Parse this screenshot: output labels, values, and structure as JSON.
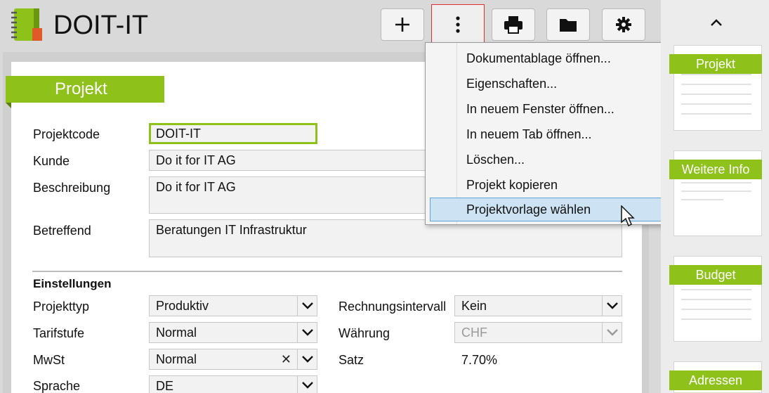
{
  "app": {
    "title": "DOIT-IT"
  },
  "toolbar": {
    "add_icon": "plus-icon",
    "more_icon": "more-vertical-icon",
    "print_icon": "printer-icon",
    "folder_icon": "folder-icon",
    "settings_icon": "gear-icon"
  },
  "section": {
    "title": "Projekt"
  },
  "form": {
    "projektcode": {
      "label": "Projektcode",
      "value": "DOIT-IT"
    },
    "kunde": {
      "label": "Kunde",
      "value": "Do it for IT AG"
    },
    "beschreibung": {
      "label": "Beschreibung",
      "value": "Do it for IT AG"
    },
    "betreffend": {
      "label": "Betreffend",
      "value": "Beratungen IT Infrastruktur"
    }
  },
  "einstellungen": {
    "heading": "Einstellungen",
    "projekttyp": {
      "label": "Projekttyp",
      "value": "Produktiv"
    },
    "tarifstufe": {
      "label": "Tarifstufe",
      "value": "Normal"
    },
    "mwst": {
      "label": "MwSt",
      "value": "Normal"
    },
    "sprache": {
      "label": "Sprache",
      "value": "DE"
    },
    "rechnungsintervall": {
      "label": "Rechnungsintervall",
      "value": "Kein"
    },
    "waehrung": {
      "label": "Währung",
      "value": "CHF"
    },
    "satz": {
      "label": "Satz",
      "value": "7.70%"
    }
  },
  "menu": {
    "items": [
      "Dokumentablage öffnen...",
      "Eigenschaften...",
      "In neuem Fenster öffnen...",
      "In neuem Tab öffnen...",
      "Löschen...",
      "Projekt kopieren",
      "Projektvorlage wählen"
    ],
    "highlighted": "Projektvorlage wählen"
  },
  "sidebar": {
    "collapse_icon": "chevron-up-icon",
    "thumbnails": [
      "Projekt",
      "Weitere Info",
      "Budget",
      "Adressen"
    ]
  },
  "colors": {
    "accent": "#8ec21a",
    "highlight": "#cde3f3",
    "focus_border": "#e23030"
  }
}
